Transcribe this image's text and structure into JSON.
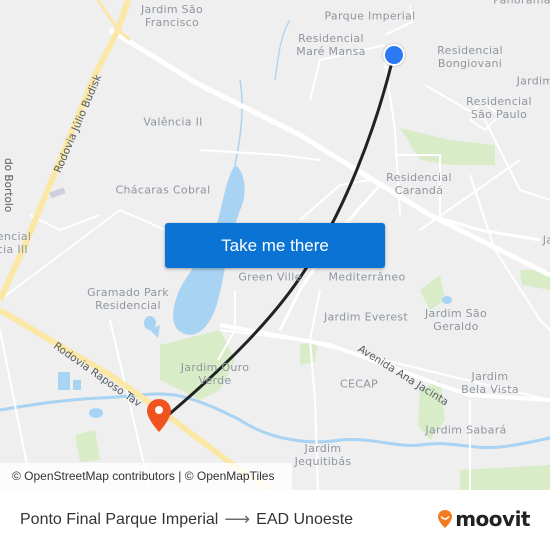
{
  "map": {
    "neighborhoods": [
      {
        "id": "jardim-sao-francisco",
        "text": "Jardim São\nFrancisco"
      },
      {
        "id": "parque-imperial",
        "text": "Parque Imperial"
      },
      {
        "id": "residencial-mare-mansa",
        "text": "Residencial\nMaré Mansa"
      },
      {
        "id": "residencial-bongiovani",
        "text": "Residencial\nBongiovani"
      },
      {
        "id": "jardim-ne",
        "text": "Jardim"
      },
      {
        "id": "residencial-sao-paulo",
        "text": "Residencial\nSão Paulo"
      },
      {
        "id": "valencia-ii",
        "text": "Valência II"
      },
      {
        "id": "chacaras-cobral",
        "text": "Chácaras Cobral"
      },
      {
        "id": "residencial-caranda",
        "text": "Residencial\nCarandá"
      },
      {
        "id": "residencial-valencia-iii",
        "text": "encial\ncia III"
      },
      {
        "id": "gramado-park",
        "text": "Gramado Park\nResidencial"
      },
      {
        "id": "green-ville",
        "text": "Green Ville"
      },
      {
        "id": "mediterraneo",
        "text": "Mediterrâneo"
      },
      {
        "id": "jardim-everest",
        "text": "Jardim Everest"
      },
      {
        "id": "jardim-sao-geraldo",
        "text": "Jardim São\nGeraldo"
      },
      {
        "id": "jardim-ouro-verde",
        "text": "Jardim Ouro\nVerde"
      },
      {
        "id": "cecap",
        "text": "CECAP"
      },
      {
        "id": "jardim-bela-vista",
        "text": "Jardim\nBela Vista"
      },
      {
        "id": "jardim-sabara",
        "text": "Jardim Sabará"
      },
      {
        "id": "jardim-jequitibas",
        "text": "Jardim\nJequitibás"
      },
      {
        "id": "panorama-partial",
        "text": "Panorama"
      },
      {
        "id": "ja-partial",
        "text": "Ja"
      }
    ],
    "roads": [
      {
        "id": "rodovia-julio-budisk",
        "text": "Rodovia Júlio Budisk"
      },
      {
        "id": "do-bortolo",
        "text": "do Bortolo"
      },
      {
        "id": "rodovia-raposo-tavares",
        "text": "Rodovia Raposo Tav"
      },
      {
        "id": "avenida-ana-jacinta",
        "text": "Avenida Ana Jacinta"
      }
    ],
    "take_me_there": "Take me there",
    "attribution": "© OpenStreetMap contributors | © OpenMapTiles",
    "colors": {
      "origin": "#2b79f3",
      "destination": "#f0541e",
      "route": "#222222",
      "button": "#0a73d4",
      "water": "#a9d3f3",
      "park": "#cfe6bf",
      "highway": "#fbe8a6"
    }
  },
  "footer": {
    "origin": "Ponto Final Parque Imperial",
    "arrow": "⟶",
    "destination": "EAD Unoeste",
    "brand": "moovit"
  }
}
